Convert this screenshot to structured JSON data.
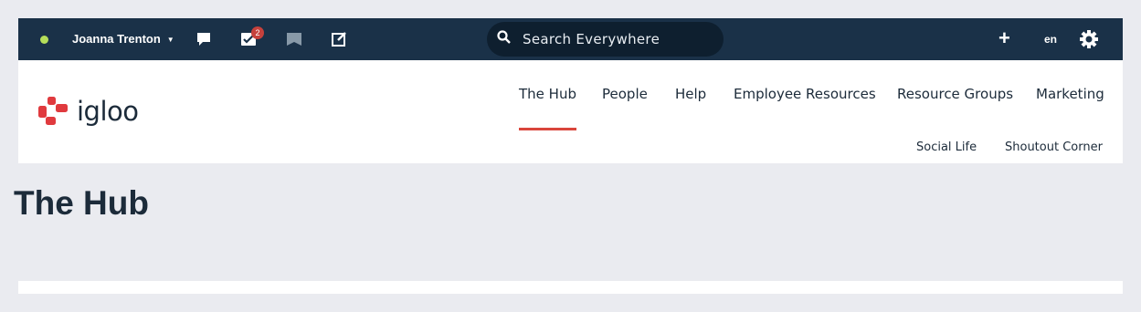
{
  "topbar": {
    "user_name": "Joanna Trenton",
    "tasks_badge": "2",
    "search_placeholder": "Search Everywhere",
    "language": "en",
    "colors": {
      "bar": "#1a3148",
      "status_online": "#b5de5a",
      "badge": "#c6413c"
    },
    "icons": [
      "status-dot",
      "chat-icon",
      "tasks-icon",
      "bookmark-icon",
      "compose-icon",
      "search-icon",
      "plus-icon",
      "gear-icon"
    ]
  },
  "header": {
    "logo_text": "igloo",
    "nav_primary": [
      {
        "label": "The Hub",
        "active": true
      },
      {
        "label": "People"
      },
      {
        "label": "Help"
      },
      {
        "label": "Employee Resources"
      },
      {
        "label": "Resource Groups"
      },
      {
        "label": "Marketing"
      }
    ],
    "nav_secondary": [
      {
        "label": "Social Life"
      },
      {
        "label": "Shoutout Corner"
      }
    ],
    "colors": {
      "active_underline": "#d9463c",
      "logo_red": "#e03a3e"
    }
  },
  "page": {
    "title": "The Hub"
  }
}
